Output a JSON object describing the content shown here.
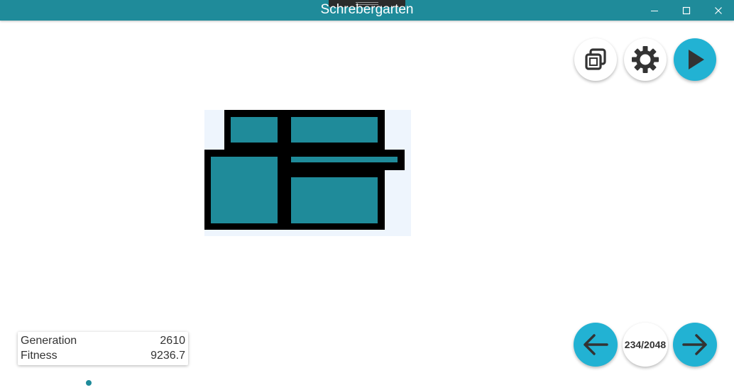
{
  "window": {
    "title": "Schrebergarten",
    "controls": [
      "minimize-icon",
      "maximize-icon",
      "close-icon"
    ]
  },
  "toolbar": {
    "buttons": [
      {
        "icon": "copy-icon"
      },
      {
        "icon": "gear-icon"
      },
      {
        "icon": "play-icon"
      }
    ]
  },
  "navigation": {
    "prev_icon": "arrow-left-icon",
    "next_icon": "arrow-right-icon",
    "counter": "234/2048"
  },
  "stats": {
    "generation_label": "Generation",
    "generation_value": "2610",
    "fitness_label": "Fitness",
    "fitness_value": "9236.7"
  },
  "colors": {
    "accent": "#1f8b9a",
    "button_accent": "#22b2d3",
    "canvas_bg": "#eef5fd",
    "plot_fill": "#1f8b9a",
    "plot_border": "#000000"
  }
}
